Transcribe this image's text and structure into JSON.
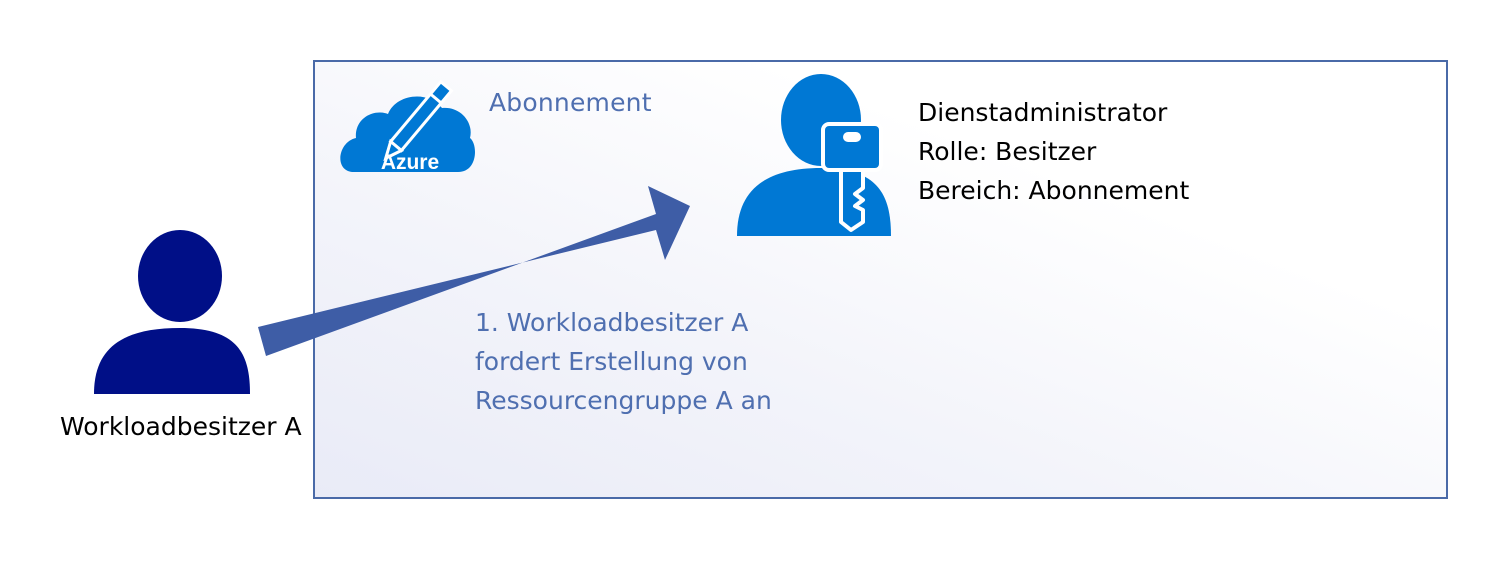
{
  "subscription": {
    "label": "Abonnement",
    "icon_text": "Azure"
  },
  "admin": {
    "title": "Dienstadministrator",
    "role": "Rolle: Besitzer",
    "scope": "Bereich: Abonnement"
  },
  "request": {
    "line1": "1. Workloadbesitzer A",
    "line2": "fordert Erstellung von",
    "line3": "Ressourcengruppe A an"
  },
  "owner": {
    "label": "Workloadbesitzer A"
  },
  "colors": {
    "box_border": "#4a6aa8",
    "arrow": "#3e5da6",
    "azure_blue": "#0078d4",
    "owner_navy": "#000f87",
    "label_blue": "#4f6fb0"
  },
  "icons": {
    "azure": "azure-cloud-pencil-icon",
    "admin": "user-key-icon",
    "owner": "user-icon"
  }
}
